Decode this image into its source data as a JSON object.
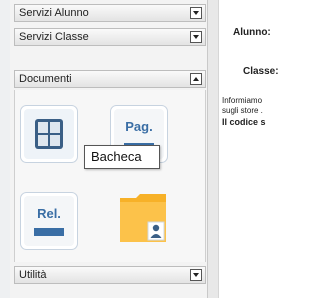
{
  "sidebar": {
    "sections": [
      {
        "label": "Servizi Alunno",
        "toggle": "expand"
      },
      {
        "label": "Servizi Classe",
        "toggle": "expand"
      },
      {
        "label": "Documenti",
        "toggle": "collapse"
      },
      {
        "label": "Utilità",
        "toggle": "expand"
      }
    ],
    "documenti": {
      "buttons": [
        {
          "label": "",
          "icon": "grid-icon"
        },
        {
          "label": "Pag.",
          "icon": "document-icon"
        },
        {
          "label": "Rel.",
          "icon": "document-icon"
        },
        {
          "label": "",
          "icon": "folder-user-icon"
        }
      ],
      "tooltip": "Bacheca"
    }
  },
  "content": {
    "alunno_label": "Alunno:",
    "classe_label": "Classe:",
    "info_lines": [
      "Informiamo",
      "sugli store ."
    ],
    "info_bold": "Il codice s"
  },
  "colors": {
    "accent_blue": "#3a6ea5",
    "folder_orange": "#f7b128"
  }
}
